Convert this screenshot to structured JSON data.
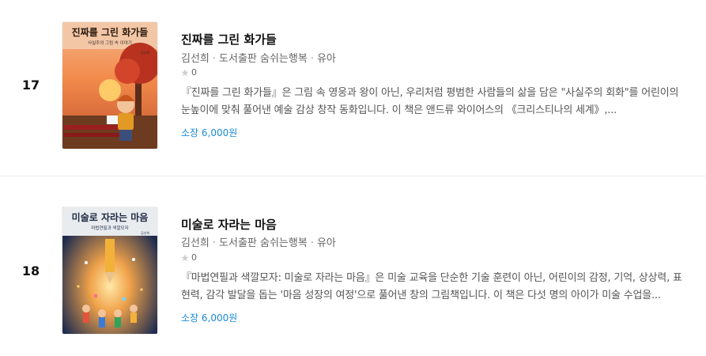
{
  "books": [
    {
      "rank": "17",
      "title": "진짜를 그린 화가들",
      "author": "김선희",
      "publisher": "도서출판 숨쉬는행복",
      "category": "유아",
      "rating_count": "0",
      "description": "『진짜를 그린 화가들』은 그림 속 영웅과 왕이 아닌, 우리처럼 평범한 사람들의 삶을 담은 \"사실주의 회화\"를 어린이의 눈높이에 맞춰 풀어낸 예술 감상 창작 동화입니다. 이 책은 앤드류 와이어스의 《크리스티나의 세계》,...",
      "price": "소장 6,000원",
      "cover": {
        "title": "진짜를 그린 화가들",
        "subtitle": "사실주의 그림 속 이야기",
        "author": "김선희"
      }
    },
    {
      "rank": "18",
      "title": "미술로 자라는 마음",
      "author": "김선희",
      "publisher": "도서출판 숨쉬는행복",
      "category": "유아",
      "rating_count": "0",
      "description": "『마법연필과 색깔모자: 미술로 자라는 마음』은 미술 교육을 단순한 기술 훈련이 아닌, 어린이의 감정, 기억, 상상력, 표현력, 감각 발달을 돕는 '마음 성장의 여정'으로 풀어낸 창의 그림책입니다. 이 책은 다섯 명의 아이가 미술 수업을...",
      "price": "소장 6,000원",
      "cover": {
        "title": "미술로 자라는 마음",
        "subtitle": "마법연필과 색깔모자",
        "author": "김선희"
      }
    }
  ],
  "colors": {
    "price": "#1a8ad8",
    "star": "#cfcfcf"
  }
}
